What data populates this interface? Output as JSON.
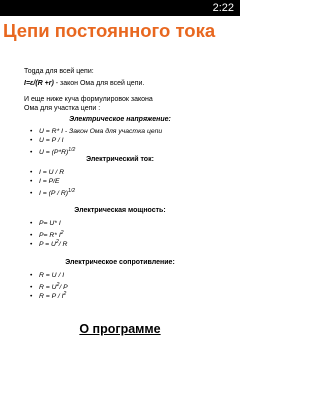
{
  "status_bar": {
    "time": "2:22"
  },
  "title": "Цепи постоянного тока",
  "intro": {
    "line1": "Тоgда для всей цепи:",
    "formula": "I=ε/(R +r)",
    "formula_desc": " - закон Ома для всей цепи.",
    "line3": "И еще ниже куча формулировок закона",
    "line4": "Ома для участка цепи :"
  },
  "sections": [
    {
      "header": "Электрическое напряжение:",
      "formulas": [
        {
          "text": "U = R* I - Закон Ома для участка цепи",
          "sup": ""
        },
        {
          "text": "U = P / I",
          "sup": ""
        },
        {
          "text": "U = (P*R)",
          "sup": "1/2"
        }
      ]
    },
    {
      "header": "Электрический ток:",
      "formulas": [
        {
          "text": "I = U / R",
          "sup": ""
        },
        {
          "text": "I = P/E",
          "sup": ""
        },
        {
          "text": "I = (P / R)",
          "sup": "1/2"
        }
      ]
    },
    {
      "header": "Электрическая мощность:",
      "formulas": [
        {
          "text": "P= U* I",
          "sup": ""
        },
        {
          "text": "P= R* I",
          "sup": "2"
        },
        {
          "text": "P = U",
          "sup": "2",
          "tail": "/ R"
        }
      ]
    },
    {
      "header": "Электрическое сопротивление:",
      "formulas": [
        {
          "text": "R = U / I",
          "sup": ""
        },
        {
          "text": "R = U",
          "sup": "2",
          "tail": "/ P"
        },
        {
          "text": "R = P / I",
          "sup": "2"
        }
      ]
    }
  ],
  "bottom_link": "О программе"
}
